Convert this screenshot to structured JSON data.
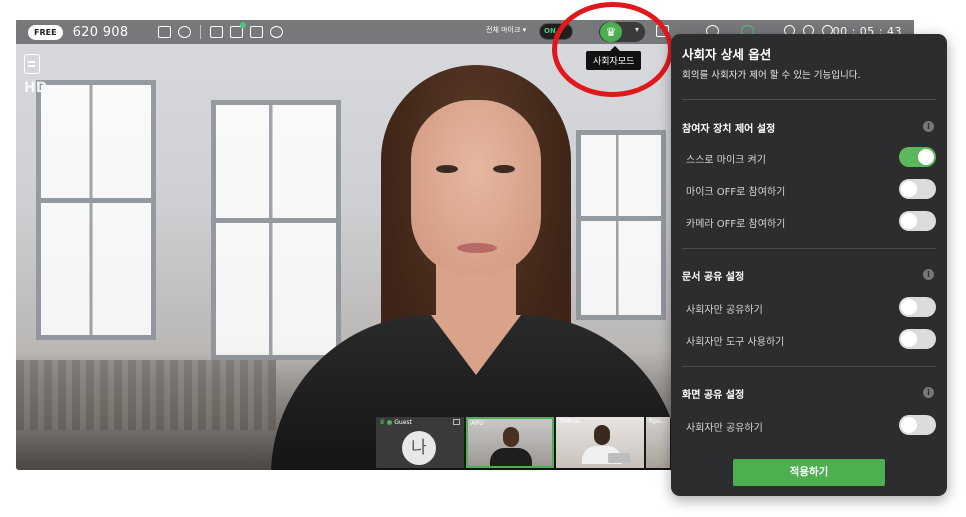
{
  "topbar": {
    "plan_badge": "FREE",
    "room_number": "620 908",
    "all_mic_label": "전체 마이크 ▾",
    "mic_toggle_label": "ON",
    "host_mode_tooltip": "사회자모드",
    "elapsed_time": "00 : 05 : 43"
  },
  "video": {
    "quality_label": "HD"
  },
  "participants": [
    {
      "name": "Guest",
      "avatar_text": "나",
      "is_host": true
    },
    {
      "name": "ARU",
      "is_speaking": true
    },
    {
      "name": "TIMinsi"
    },
    {
      "name": "Rpo..."
    }
  ],
  "panel": {
    "title": "사회자 상세 옵션",
    "subtitle": "회의를 사회자가 제어 할 수 있는 기능입니다.",
    "sections": [
      {
        "title": "참여자 장치 제어 설정",
        "options": [
          {
            "label": "스스로 마이크 켜기",
            "enabled": true
          },
          {
            "label": "마이크 OFF로 참여하기",
            "enabled": false
          },
          {
            "label": "카메라 OFF로 참여하기",
            "enabled": false
          }
        ]
      },
      {
        "title": "문서 공유 설정",
        "options": [
          {
            "label": "사회자만 공유하기",
            "enabled": false
          },
          {
            "label": "사회자만 도구 사용하기",
            "enabled": false
          }
        ]
      },
      {
        "title": "화면 공유 설정",
        "options": [
          {
            "label": "사회자만 공유하기",
            "enabled": false
          }
        ]
      }
    ],
    "apply_label": "적용하기"
  },
  "colors": {
    "accent_green": "#4caf50",
    "highlight_red": "#e0181b",
    "panel_bg": "#2d2d2f"
  }
}
